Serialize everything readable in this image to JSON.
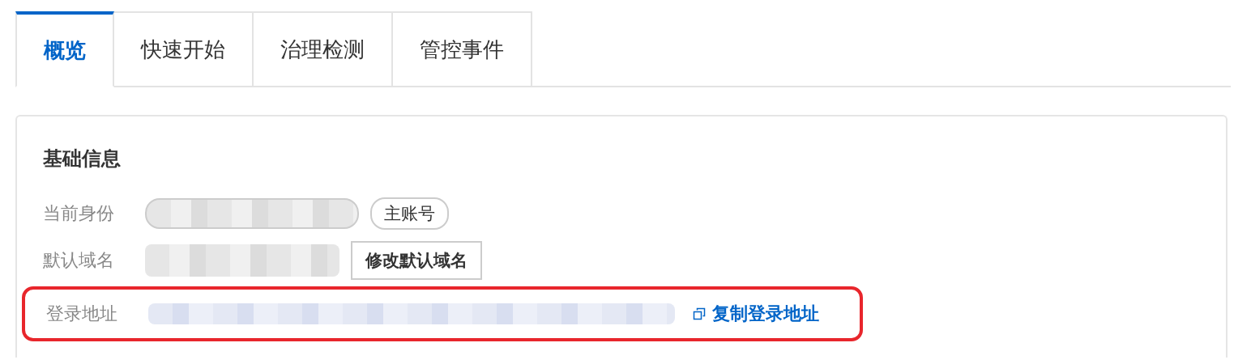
{
  "tabs": [
    {
      "label": "概览",
      "selected": true
    },
    {
      "label": "快速开始",
      "selected": false
    },
    {
      "label": "治理检测",
      "selected": false
    },
    {
      "label": "管控事件",
      "selected": false
    }
  ],
  "section": {
    "title": "基础信息",
    "rows": [
      {
        "label": "当前身份",
        "kind": "badge",
        "action": "主账号",
        "highlighted": false
      },
      {
        "label": "默认域名",
        "kind": "button",
        "action": "修改默认域名",
        "highlighted": false
      },
      {
        "label": "登录地址",
        "kind": "link",
        "action": "复制登录地址",
        "highlighted": true
      }
    ]
  }
}
